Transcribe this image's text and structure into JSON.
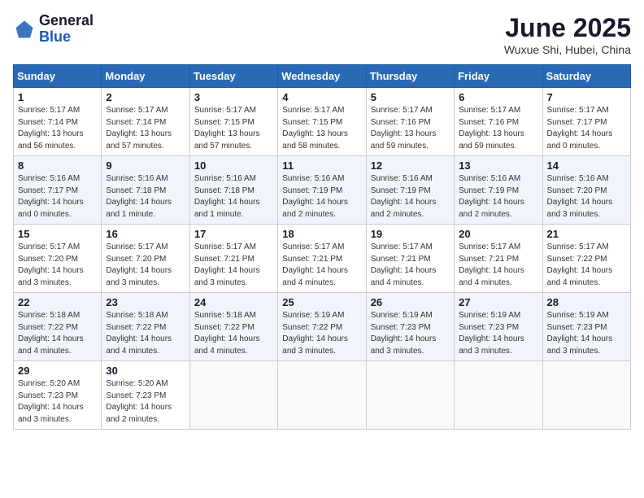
{
  "header": {
    "logo_general": "General",
    "logo_blue": "Blue",
    "month_title": "June 2025",
    "subtitle": "Wuxue Shi, Hubei, China"
  },
  "days_of_week": [
    "Sunday",
    "Monday",
    "Tuesday",
    "Wednesday",
    "Thursday",
    "Friday",
    "Saturday"
  ],
  "weeks": [
    [
      {
        "num": "1",
        "sunrise": "5:17 AM",
        "sunset": "7:14 PM",
        "daylight": "13 hours and 56 minutes."
      },
      {
        "num": "2",
        "sunrise": "5:17 AM",
        "sunset": "7:14 PM",
        "daylight": "13 hours and 57 minutes."
      },
      {
        "num": "3",
        "sunrise": "5:17 AM",
        "sunset": "7:15 PM",
        "daylight": "13 hours and 57 minutes."
      },
      {
        "num": "4",
        "sunrise": "5:17 AM",
        "sunset": "7:15 PM",
        "daylight": "13 hours and 58 minutes."
      },
      {
        "num": "5",
        "sunrise": "5:17 AM",
        "sunset": "7:16 PM",
        "daylight": "13 hours and 59 minutes."
      },
      {
        "num": "6",
        "sunrise": "5:17 AM",
        "sunset": "7:16 PM",
        "daylight": "13 hours and 59 minutes."
      },
      {
        "num": "7",
        "sunrise": "5:17 AM",
        "sunset": "7:17 PM",
        "daylight": "14 hours and 0 minutes."
      }
    ],
    [
      {
        "num": "8",
        "sunrise": "5:16 AM",
        "sunset": "7:17 PM",
        "daylight": "14 hours and 0 minutes."
      },
      {
        "num": "9",
        "sunrise": "5:16 AM",
        "sunset": "7:18 PM",
        "daylight": "14 hours and 1 minute."
      },
      {
        "num": "10",
        "sunrise": "5:16 AM",
        "sunset": "7:18 PM",
        "daylight": "14 hours and 1 minute."
      },
      {
        "num": "11",
        "sunrise": "5:16 AM",
        "sunset": "7:19 PM",
        "daylight": "14 hours and 2 minutes."
      },
      {
        "num": "12",
        "sunrise": "5:16 AM",
        "sunset": "7:19 PM",
        "daylight": "14 hours and 2 minutes."
      },
      {
        "num": "13",
        "sunrise": "5:16 AM",
        "sunset": "7:19 PM",
        "daylight": "14 hours and 2 minutes."
      },
      {
        "num": "14",
        "sunrise": "5:16 AM",
        "sunset": "7:20 PM",
        "daylight": "14 hours and 3 minutes."
      }
    ],
    [
      {
        "num": "15",
        "sunrise": "5:17 AM",
        "sunset": "7:20 PM",
        "daylight": "14 hours and 3 minutes."
      },
      {
        "num": "16",
        "sunrise": "5:17 AM",
        "sunset": "7:20 PM",
        "daylight": "14 hours and 3 minutes."
      },
      {
        "num": "17",
        "sunrise": "5:17 AM",
        "sunset": "7:21 PM",
        "daylight": "14 hours and 3 minutes."
      },
      {
        "num": "18",
        "sunrise": "5:17 AM",
        "sunset": "7:21 PM",
        "daylight": "14 hours and 4 minutes."
      },
      {
        "num": "19",
        "sunrise": "5:17 AM",
        "sunset": "7:21 PM",
        "daylight": "14 hours and 4 minutes."
      },
      {
        "num": "20",
        "sunrise": "5:17 AM",
        "sunset": "7:21 PM",
        "daylight": "14 hours and 4 minutes."
      },
      {
        "num": "21",
        "sunrise": "5:17 AM",
        "sunset": "7:22 PM",
        "daylight": "14 hours and 4 minutes."
      }
    ],
    [
      {
        "num": "22",
        "sunrise": "5:18 AM",
        "sunset": "7:22 PM",
        "daylight": "14 hours and 4 minutes."
      },
      {
        "num": "23",
        "sunrise": "5:18 AM",
        "sunset": "7:22 PM",
        "daylight": "14 hours and 4 minutes."
      },
      {
        "num": "24",
        "sunrise": "5:18 AM",
        "sunset": "7:22 PM",
        "daylight": "14 hours and 4 minutes."
      },
      {
        "num": "25",
        "sunrise": "5:19 AM",
        "sunset": "7:22 PM",
        "daylight": "14 hours and 3 minutes."
      },
      {
        "num": "26",
        "sunrise": "5:19 AM",
        "sunset": "7:23 PM",
        "daylight": "14 hours and 3 minutes."
      },
      {
        "num": "27",
        "sunrise": "5:19 AM",
        "sunset": "7:23 PM",
        "daylight": "14 hours and 3 minutes."
      },
      {
        "num": "28",
        "sunrise": "5:19 AM",
        "sunset": "7:23 PM",
        "daylight": "14 hours and 3 minutes."
      }
    ],
    [
      {
        "num": "29",
        "sunrise": "5:20 AM",
        "sunset": "7:23 PM",
        "daylight": "14 hours and 3 minutes."
      },
      {
        "num": "30",
        "sunrise": "5:20 AM",
        "sunset": "7:23 PM",
        "daylight": "14 hours and 2 minutes."
      },
      null,
      null,
      null,
      null,
      null
    ]
  ]
}
